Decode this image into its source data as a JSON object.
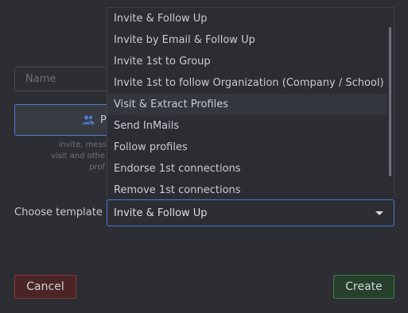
{
  "form": {
    "name_placeholder": "Name",
    "pe_button_label": "Pe",
    "description_lines": [
      "invite, mess",
      "visit and othe",
      "prof"
    ]
  },
  "template": {
    "label": "Choose template",
    "selected": "Invite & Follow Up",
    "options": [
      "Invite & Follow Up",
      "Invite by Email & Follow Up",
      "Invite 1st to Group",
      "Invite 1st to follow Organization (Company / School)",
      "Visit & Extract Profiles",
      "Send InMails",
      "Follow profiles",
      "Endorse 1st connections",
      "Remove 1st connections"
    ],
    "hovered_option": "Visit & Extract Profiles"
  },
  "actions": {
    "cancel_label": "Cancel",
    "create_label": "Create"
  },
  "icons": {
    "pe_button_icon": "people-icon",
    "select_caret": "caret-down-icon"
  },
  "colors": {
    "accent": "#4e78d1",
    "cancel_border": "#8a3a38",
    "create_border": "#3f7d46",
    "background": "#2c2e34"
  }
}
